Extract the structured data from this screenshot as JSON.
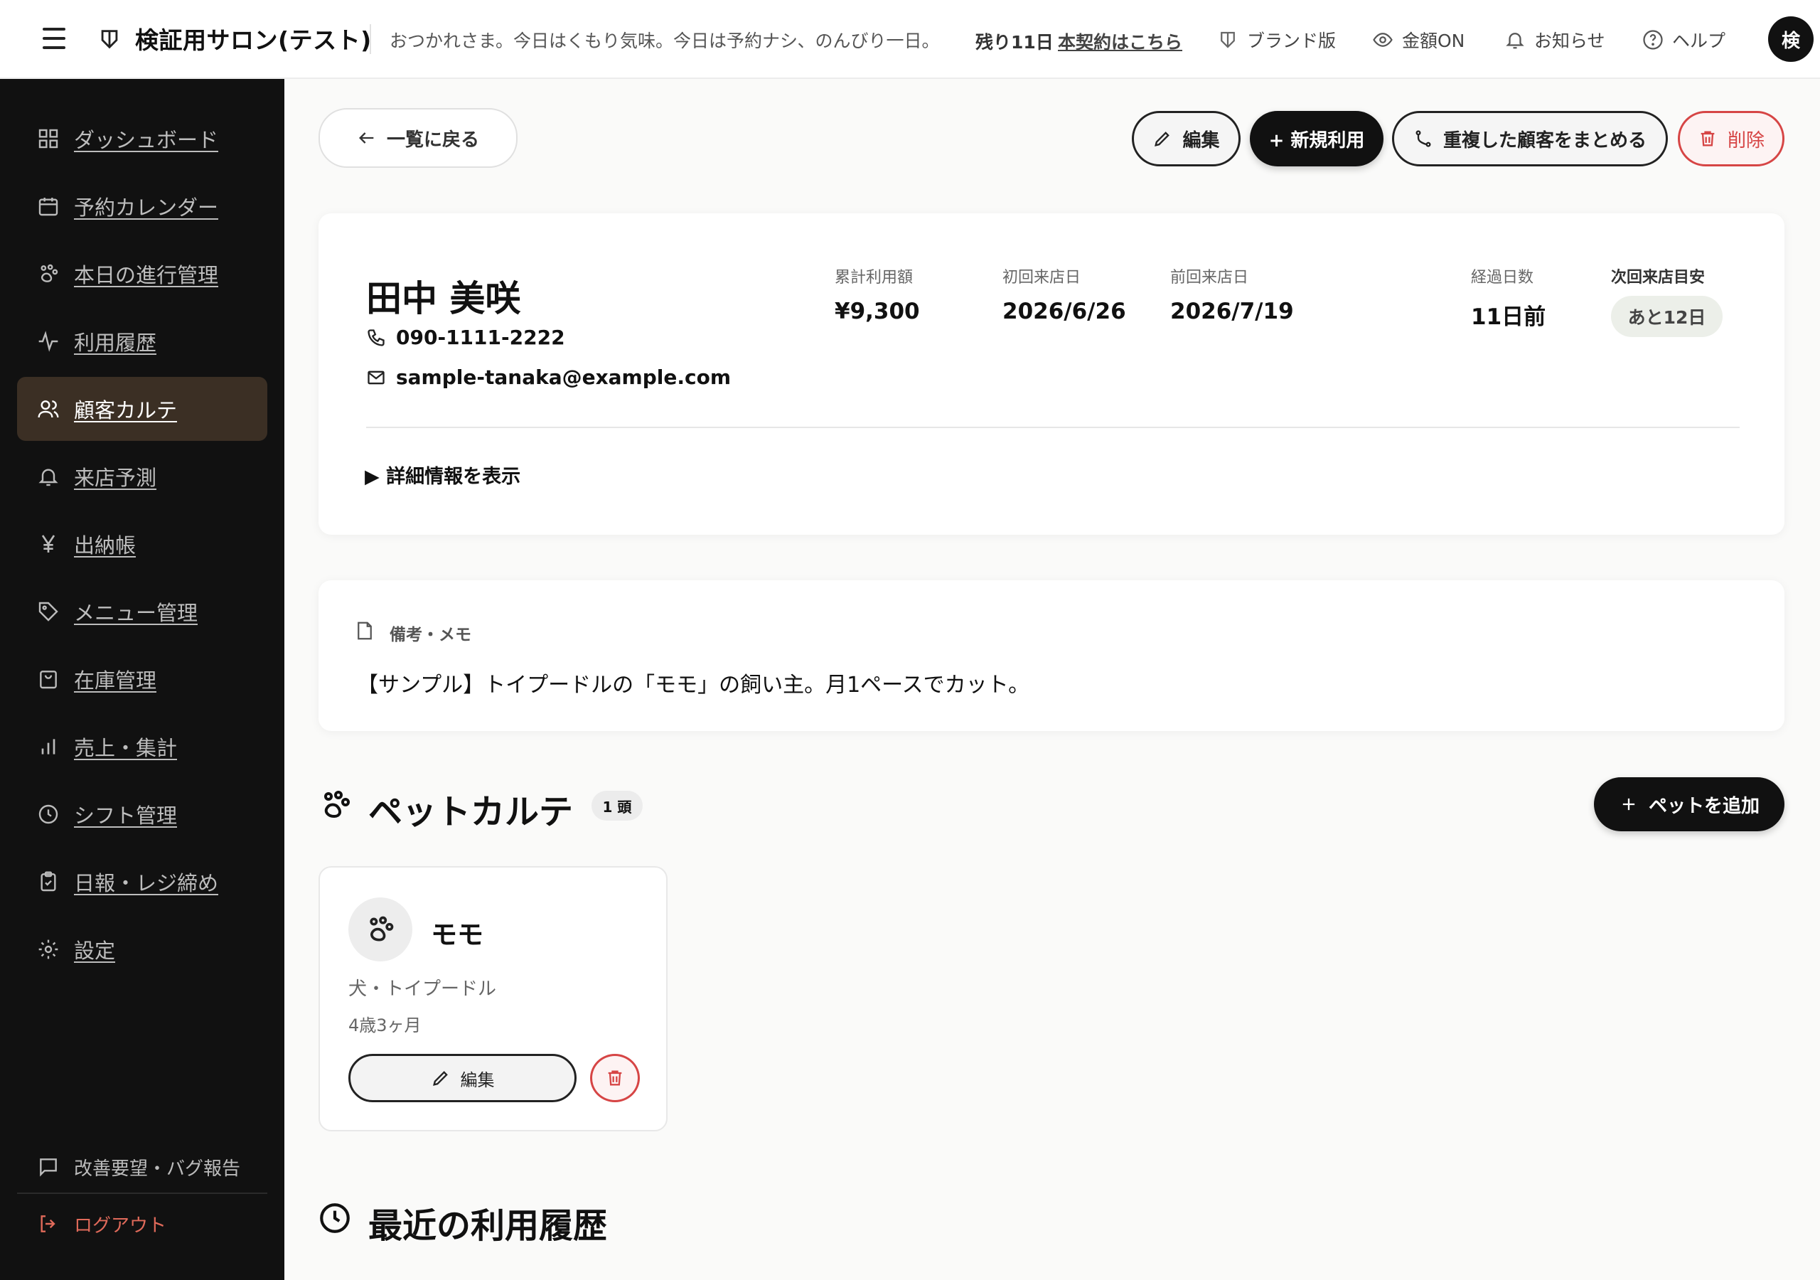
{
  "header": {
    "salon_name": "検証用サロン(テスト)",
    "greeting": "おつかれさま。今日はくもり気味。今日は予約ナシ、のんびり一日。",
    "trial_remaining": "残り11日",
    "trial_link": "本契約はこちら",
    "nav": [
      {
        "label": "ブランド版",
        "icon": "brand-icon"
      },
      {
        "label": "金額ON",
        "icon": "eye-icon"
      },
      {
        "label": "お知らせ",
        "icon": "bell-icon"
      },
      {
        "label": "ヘルプ",
        "icon": "help-icon"
      }
    ],
    "avatar_initial": "検"
  },
  "sidebar": {
    "items": [
      {
        "label": "ダッシュボード",
        "icon": "dashboard-icon"
      },
      {
        "label": "予約カレンダー",
        "icon": "calendar-icon"
      },
      {
        "label": "本日の進行管理",
        "icon": "paw-icon"
      },
      {
        "label": "利用履歴",
        "icon": "activity-icon"
      },
      {
        "label": "顧客カルテ",
        "icon": "users-icon",
        "active": true
      },
      {
        "label": "来店予測",
        "icon": "bell-icon"
      },
      {
        "label": "出納帳",
        "icon": "yen-icon"
      },
      {
        "label": "メニュー管理",
        "icon": "tag-icon"
      },
      {
        "label": "在庫管理",
        "icon": "bag-icon"
      },
      {
        "label": "売上・集計",
        "icon": "bar-chart-icon"
      },
      {
        "label": "シフト管理",
        "icon": "clock-icon"
      },
      {
        "label": "日報・レジ締め",
        "icon": "clipboard-icon"
      },
      {
        "label": "設定",
        "icon": "gear-icon"
      }
    ],
    "feedback": "改善要望・バグ報告",
    "logout": "ログアウト"
  },
  "toolbar": {
    "back": "一覧に戻る",
    "edit": "編集",
    "new_use": "+ 新規利用",
    "merge": "重複した顧客をまとめる",
    "delete": "削除"
  },
  "customer": {
    "name": "田中 美咲",
    "phone": "090-1111-2222",
    "email": "sample-tanaka@example.com",
    "stats": [
      {
        "label": "累計利用額",
        "value": "¥9,300"
      },
      {
        "label": "初回来店日",
        "value": "2026/6/26"
      },
      {
        "label": "前回来店日",
        "value": "2026/7/19"
      },
      {
        "label": "経過日数",
        "value": "11日前"
      }
    ],
    "next_visit_label": "次回来店目安",
    "next_visit_badge": "あと12日",
    "details_toggle": "▶ 詳細情報を表示"
  },
  "memo": {
    "title": "備考・メモ",
    "body": "【サンプル】トイプードルの「モモ」の飼い主。月1ペースでカット。"
  },
  "pets": {
    "title": "ペットカルテ",
    "count": "1 頭",
    "add": "ペットを追加",
    "items": [
      {
        "name": "モモ",
        "breed": "犬・トイプードル",
        "age": "4歳3ヶ月",
        "edit": "編集"
      }
    ]
  },
  "history": {
    "title": "最近の利用履歴"
  },
  "colors": {
    "sidebar_bg": "#111111",
    "active_bg": "#3b2f24",
    "danger": "#d64545",
    "primary": "#111111"
  }
}
